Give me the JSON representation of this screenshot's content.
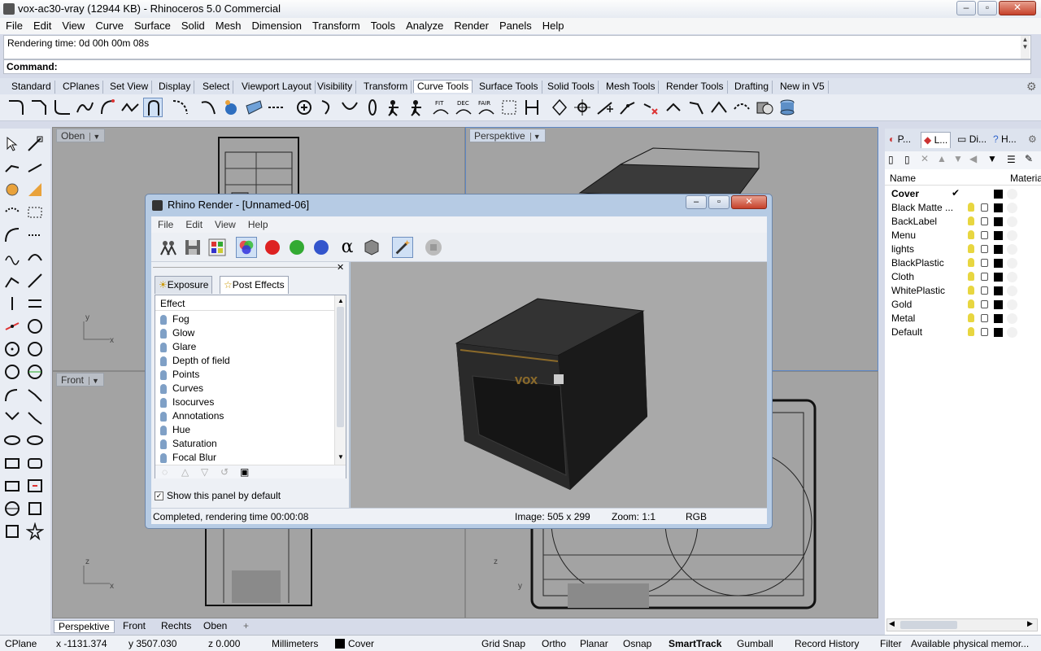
{
  "window": {
    "title": "vox-ac30-vray (12944 KB) - Rhinoceros 5.0 Commercial"
  },
  "menu": [
    "File",
    "Edit",
    "View",
    "Curve",
    "Surface",
    "Solid",
    "Mesh",
    "Dimension",
    "Transform",
    "Tools",
    "Analyze",
    "Render",
    "Panels",
    "Help"
  ],
  "command": {
    "history": "Rendering time: 0d 00h 00m 08s",
    "prompt": "Command:"
  },
  "toolbar_tabs": [
    "Standard",
    "CPlanes",
    "Set View",
    "Display",
    "Select",
    "Viewport Layout",
    "Visibility",
    "Transform",
    "Curve Tools",
    "Surface Tools",
    "Solid Tools",
    "Mesh Tools",
    "Render Tools",
    "Drafting",
    "New in V5"
  ],
  "toolbar_active_tab": "Curve Tools",
  "viewports": {
    "top_left": "Oben",
    "top_right": "Perspektive",
    "bottom_left": "Front"
  },
  "viewport_tabs": [
    "Perspektive",
    "Front",
    "Rechts",
    "Oben"
  ],
  "statusbar": {
    "cplane": "CPlane",
    "x": "x -1131.374",
    "y": "y 3507.030",
    "z": "z 0.000",
    "units": "Millimeters",
    "layer": "Cover",
    "toggles": [
      "Grid Snap",
      "Ortho",
      "Planar",
      "Osnap",
      "SmartTrack",
      "Gumball",
      "Record History",
      "Filter"
    ],
    "memory": "Available physical memor..."
  },
  "panel": {
    "tabs": [
      "P...",
      "L...",
      "Di...",
      "H..."
    ],
    "columns": {
      "name": "Name",
      "material": "Material"
    },
    "layers": [
      "Cover",
      "Black Matte ...",
      "BackLabel",
      "Menu",
      "lights",
      "BlackPlastic",
      "Cloth",
      "WhitePlastic",
      "Gold",
      "Metal",
      "Default"
    ],
    "current_check": "✔"
  },
  "render_window": {
    "title": "Rhino Render - [Unnamed-06]",
    "menu": [
      "File",
      "Edit",
      "View",
      "Help"
    ],
    "tabs": [
      "Exposure",
      "Post Effects"
    ],
    "list_header": "Effect",
    "effects": [
      "Fog",
      "Glow",
      "Glare",
      "Depth of field",
      "Points",
      "Curves",
      "Isocurves",
      "Annotations",
      "Hue",
      "Saturation",
      "Focal Blur"
    ],
    "checkbox_label": "Show this panel by default",
    "status": "Completed, rendering time 00:00:08",
    "image_size": "Image: 505 x 299",
    "zoom": "Zoom: 1:1",
    "channel": "RGB",
    "close_x": "✕",
    "alpha_glyph": "α"
  },
  "axes": {
    "x": "x",
    "y": "y",
    "z": "z"
  },
  "colors": {
    "viewport_bg": "#a3a3a3",
    "active_tab": "#ffffff",
    "accent": "#3b6ea5"
  }
}
